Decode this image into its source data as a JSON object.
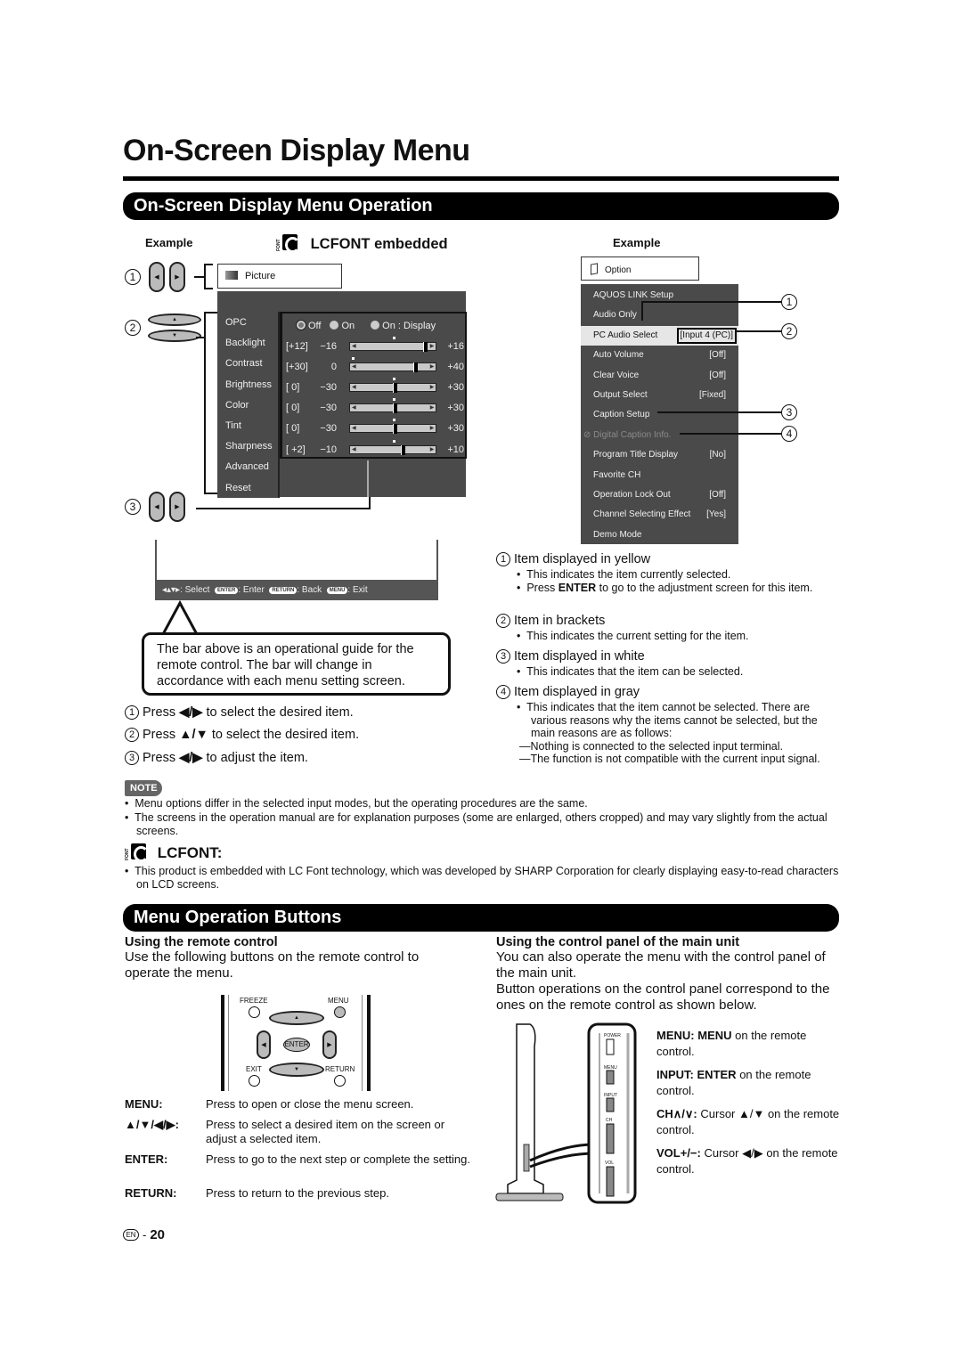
{
  "page": {
    "title": "On-Screen Display Menu",
    "section1_title": "On-Screen Display Menu Operation",
    "section2_title": "Menu Operation Buttons",
    "page_lang": "EN",
    "page_number": "20"
  },
  "left_example": {
    "label": "Example",
    "lcfont_heading": "LCFONT embedded",
    "font_logo_letters": "FONT",
    "tab_label": "Picture",
    "callout_numbers": [
      "1",
      "2",
      "3"
    ],
    "menu_items": [
      "OPC",
      "Backlight",
      "Contrast",
      "Brightness",
      "Color",
      "Tint",
      "Sharpness",
      "Advanced",
      "Reset"
    ],
    "opc_options": [
      {
        "label": "Off",
        "selected": true
      },
      {
        "label": "On",
        "selected": false
      },
      {
        "label": "On : Display",
        "selected": false
      }
    ],
    "sliders": [
      {
        "name": "Backlight",
        "current": "[+12]",
        "min": "−16",
        "max": "+16",
        "value": 12,
        "range": [
          -16,
          16
        ]
      },
      {
        "name": "Contrast",
        "current": "[+30]",
        "min": "0",
        "max": "+40",
        "value": 30,
        "range": [
          0,
          40
        ]
      },
      {
        "name": "Brightness",
        "current": "[   0]",
        "min": "−30",
        "max": "+30",
        "value": 0,
        "range": [
          -30,
          30
        ]
      },
      {
        "name": "Color",
        "current": "[   0]",
        "min": "−30",
        "max": "+30",
        "value": 0,
        "range": [
          -30,
          30
        ]
      },
      {
        "name": "Tint",
        "current": "[   0]",
        "min": "−30",
        "max": "+30",
        "value": 0,
        "range": [
          -30,
          30
        ]
      },
      {
        "name": "Sharpness",
        "current": "[ +2]",
        "min": "−10",
        "max": "+10",
        "value": 2,
        "range": [
          -10,
          10
        ]
      }
    ],
    "guide_bar": {
      "select": ": Select",
      "enter_key": "ENTER",
      "enter": ": Enter",
      "return_key": "RETURN",
      "back": ": Back",
      "menu_key": "MENU",
      "exit": ": Exit"
    },
    "callout_text": "The bar above is an operational guide for the remote control. The bar will change in accordance with each menu setting screen.",
    "steps": [
      {
        "num": "1",
        "pre": "Press",
        "keys": "◀/▶",
        "text": "to select the desired item."
      },
      {
        "num": "2",
        "pre": "Press",
        "keys": "▲/▼",
        "text": "to select the desired item."
      },
      {
        "num": "3",
        "pre": "Press",
        "keys": "◀/▶",
        "text": "to adjust the item."
      }
    ]
  },
  "right_example": {
    "label": "Example",
    "tab_label": "Option",
    "items": [
      {
        "label": "AQUOS LINK Setup",
        "value": "",
        "state": "normal"
      },
      {
        "label": "Audio Only",
        "value": "",
        "state": "normal"
      },
      {
        "label": "PC Audio Select",
        "value": "[Input 4 (PC)]",
        "state": "selected"
      },
      {
        "label": "Auto Volume",
        "value": "[Off]",
        "state": "normal"
      },
      {
        "label": "Clear Voice",
        "value": "[Off]",
        "state": "normal"
      },
      {
        "label": "Output Select",
        "value": "[Fixed]",
        "state": "normal"
      },
      {
        "label": "Caption Setup",
        "value": "",
        "state": "normal"
      },
      {
        "label": "Digital Caption Info.",
        "value": "",
        "state": "disabled"
      },
      {
        "label": "Program Title Display",
        "value": "[No]",
        "state": "normal"
      },
      {
        "label": "Favorite CH",
        "value": "",
        "state": "normal"
      },
      {
        "label": "Operation Lock Out",
        "value": "[Off]",
        "state": "normal"
      },
      {
        "label": "Channel Selecting Effect",
        "value": "[Yes]",
        "state": "normal"
      },
      {
        "label": "Demo Mode",
        "value": "",
        "state": "normal"
      }
    ],
    "callout_numbers": [
      "1",
      "2",
      "3",
      "4"
    ]
  },
  "legend": [
    {
      "num": "1",
      "title": "Item displayed in yellow",
      "bullets": [
        "This indicates the item currently selected.",
        "Press ENTER to go to the adjustment screen for this item."
      ],
      "bold_word": "ENTER"
    },
    {
      "num": "2",
      "title": "Item in brackets",
      "bullets": [
        "This indicates the current setting for the item."
      ]
    },
    {
      "num": "3",
      "title": "Item displayed in white",
      "bullets": [
        "This indicates that the item can be selected."
      ]
    },
    {
      "num": "4",
      "title": "Item displayed in gray",
      "bullets": [
        "This indicates that the item cannot be selected. There are various reasons why the items cannot be selected, but the main reasons are as follows:"
      ],
      "dashes": [
        "Nothing is connected to the selected input terminal.",
        "The function is not compatible with the current input signal."
      ]
    }
  ],
  "note": {
    "badge": "NOTE",
    "bullets": [
      "Menu options differ in the selected input modes, but the operating procedures are the same.",
      "The screens in the operation manual are for explanation purposes (some are enlarged, others cropped) and may vary slightly from the actual screens."
    ]
  },
  "lcfont": {
    "heading": "LCFONT:",
    "text": "This product is embedded with LC Font technology, which was developed by SHARP Corporation for clearly displaying easy-to-read characters on LCD screens."
  },
  "remote": {
    "heading": "Using the remote control",
    "intro": "Use the following buttons on the remote control to operate the menu.",
    "buttons": {
      "freeze": "FREEZE",
      "menu": "MENU",
      "enter": "ENTER",
      "exit": "EXIT",
      "return": "RETURN"
    },
    "definitions": [
      {
        "key": "MENU:",
        "desc": "Press to open or close the menu screen."
      },
      {
        "key": "▲/▼/◀/▶:",
        "desc": "Press to select a desired item on the screen or adjust a selected item."
      },
      {
        "key": "ENTER:",
        "desc": "Press to go to the next step or complete the setting."
      },
      {
        "key": "RETURN:",
        "desc": "Press to return to the previous step."
      }
    ]
  },
  "control_panel": {
    "heading": "Using the control panel of the main unit",
    "intro1": "You can also operate the menu with the control panel of the main unit.",
    "intro2": "Button operations on the control panel correspond to the ones on the remote control as shown below.",
    "panel_labels": [
      "POWER",
      "MENU",
      "INPUT",
      "CH",
      "VOL"
    ],
    "mappings": [
      {
        "key": "MENU:",
        "target": "MENU",
        "rest": "on the remote control."
      },
      {
        "key": "INPUT:",
        "target": "ENTER",
        "rest": "on the remote control."
      },
      {
        "key": "CH∧/∨:",
        "target": "",
        "rest": "Cursor ▲/▼ on the remote control."
      },
      {
        "key": "VOL+/−:",
        "target": "",
        "rest": "Cursor ◀/▶ on the remote control."
      }
    ]
  }
}
